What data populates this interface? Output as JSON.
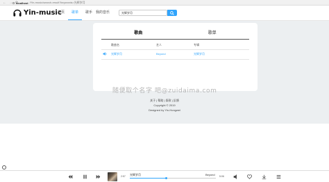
{
  "browser": {
    "back": "←",
    "forward": "→",
    "refresh": "⟳",
    "host": "localhost",
    "path": "/Yin-music/search-result?keywords=光辉岁月"
  },
  "header": {
    "logo_text": "Yin-music",
    "nav": [
      "首页",
      "歌单",
      "歌手",
      "我的音乐"
    ],
    "active_nav": 1,
    "search_value": "光辉岁月"
  },
  "results": {
    "tabs": [
      "歌曲",
      "歌单"
    ],
    "active_tab": 0,
    "columns": [
      "歌曲名",
      "艺人",
      "专辑"
    ],
    "rows": [
      {
        "song": "光辉岁月",
        "artist": "Beyond",
        "album": "光辉岁月"
      }
    ]
  },
  "watermark": "随便取个名字 吧@zuidaima.com",
  "footer": {
    "links": "关于 | 帮助 | 条款 | 反馈",
    "copyright": "Copyright © 2019",
    "designed": "Designed by Yin-Hongwei"
  },
  "player": {
    "current_time": "2:57",
    "title": "光辉岁月",
    "artist": "Beyond",
    "total_time": "5:06",
    "progress": 0.42,
    "accent": "#30a4fc"
  }
}
